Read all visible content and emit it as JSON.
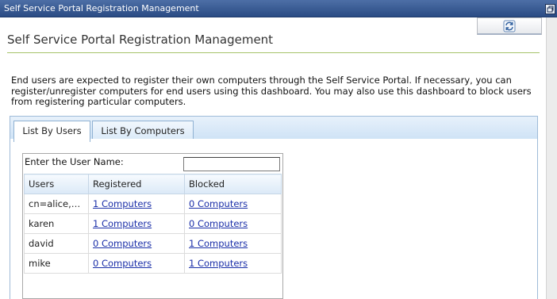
{
  "window": {
    "title": "Self Service Portal Registration Management",
    "restore_icon": "restore-icon"
  },
  "toolbar": {
    "refresh_icon": "refresh-icon"
  },
  "page": {
    "title": "Self Service Portal Registration Management",
    "intro_line1": "End users are expected to register their own computers through the Self Service Portal. If necessary, you can",
    "intro_line2": "register/unregister computers for end users using this dashboard. You may also use this dashboard to block users",
    "intro_line3": "from registering particular computers."
  },
  "tabs": [
    {
      "label": "List By Users",
      "active": true
    },
    {
      "label": "List By Computers",
      "active": false
    }
  ],
  "filter": {
    "label": "Enter the User Name:",
    "value": ""
  },
  "table": {
    "columns": [
      "Users",
      "Registered",
      "Blocked"
    ],
    "rows": [
      {
        "user": "cn=alice,o...",
        "registered": "1 Computers",
        "blocked": "0 Computers"
      },
      {
        "user": "karen",
        "registered": "1 Computers",
        "blocked": "0 Computers"
      },
      {
        "user": "david",
        "registered": "0 Computers",
        "blocked": "1 Computers"
      },
      {
        "user": "mike",
        "registered": "0 Computers",
        "blocked": "1 Computers"
      }
    ]
  },
  "colors": {
    "titlebar": "#2a4b84",
    "accent_rule": "#a6c36a",
    "link": "#1a2ea8",
    "tab_bar": "#cfe3f6"
  }
}
